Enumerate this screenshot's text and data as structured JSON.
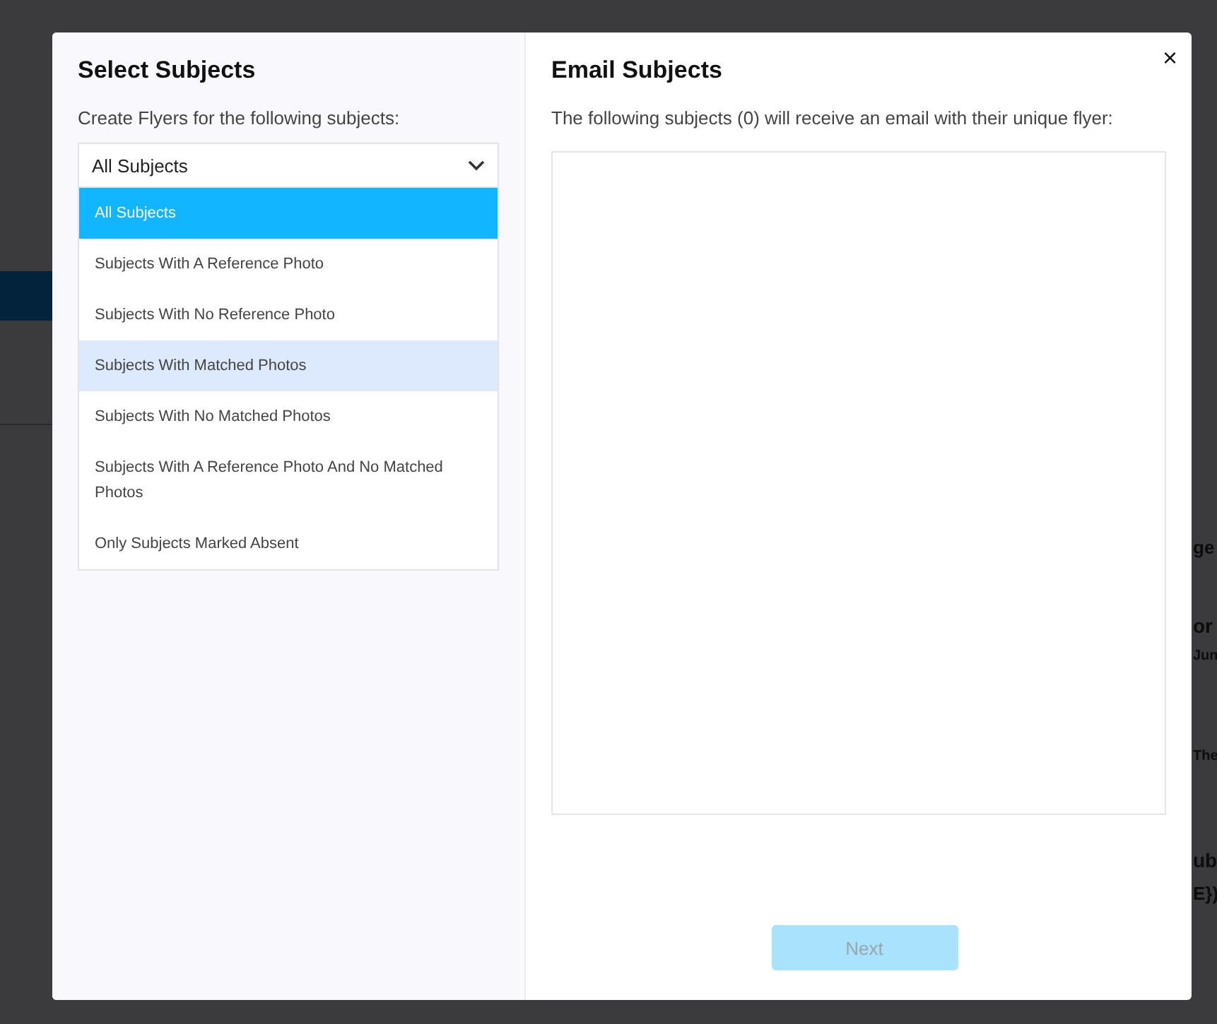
{
  "background": {
    "fragments": [
      {
        "kind": "text",
        "text": "ge"
      },
      {
        "kind": "heading",
        "text": "or"
      },
      {
        "kind": "small",
        "text": "Jun"
      },
      {
        "kind": "small",
        "text": "The"
      },
      {
        "kind": "heading",
        "text": "ub"
      },
      {
        "kind": "text",
        "text": "E})"
      }
    ]
  },
  "modal": {
    "left": {
      "title": "Select Subjects",
      "subtitle": "Create Flyers for the following subjects:",
      "dropdown": {
        "value": "All Subjects",
        "expanded": true,
        "options": [
          {
            "label": "All Subjects",
            "selected": true,
            "highlighted": false
          },
          {
            "label": "Subjects With A Reference Photo",
            "selected": false,
            "highlighted": false
          },
          {
            "label": "Subjects With No Reference Photo",
            "selected": false,
            "highlighted": false
          },
          {
            "label": "Subjects With Matched Photos",
            "selected": false,
            "highlighted": true
          },
          {
            "label": "Subjects With No Matched Photos",
            "selected": false,
            "highlighted": false
          },
          {
            "label": "Subjects With A Reference Photo And No Matched Photos",
            "selected": false,
            "highlighted": false
          },
          {
            "label": "Only Subjects Marked Absent",
            "selected": false,
            "highlighted": false
          }
        ]
      }
    },
    "right": {
      "title": "Email Subjects",
      "description": "The following subjects (0) will receive an email with their unique flyer:",
      "button": {
        "label": "Next",
        "disabled": true
      }
    },
    "close": "×"
  }
}
